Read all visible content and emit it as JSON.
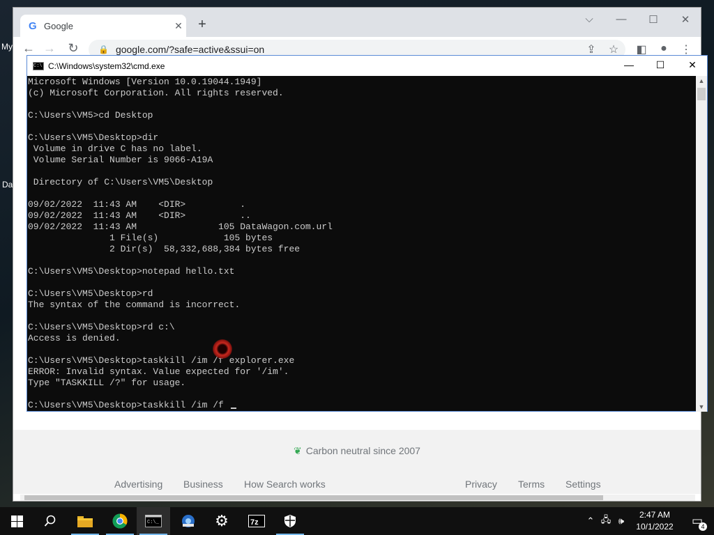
{
  "desktop": {
    "icon_labels": [
      "My",
      "Da"
    ]
  },
  "chrome": {
    "tab_title": "Google",
    "url": "google.com/?safe=active&ssui=on",
    "footer": {
      "carbon_text": "Carbon neutral since 2007",
      "left_links": [
        "Advertising",
        "Business",
        "How Search works"
      ],
      "right_links": [
        "Privacy",
        "Terms",
        "Settings"
      ]
    }
  },
  "cmd": {
    "title": "C:\\Windows\\system32\\cmd.exe",
    "lines": [
      "Microsoft Windows [Version 10.0.19044.1949]",
      "(c) Microsoft Corporation. All rights reserved.",
      "",
      "C:\\Users\\VM5>cd Desktop",
      "",
      "C:\\Users\\VM5\\Desktop>dir",
      " Volume in drive C has no label.",
      " Volume Serial Number is 9066-A19A",
      "",
      " Directory of C:\\Users\\VM5\\Desktop",
      "",
      "09/02/2022  11:43 AM    <DIR>          .",
      "09/02/2022  11:43 AM    <DIR>          ..",
      "09/02/2022  11:43 AM               105 DataWagon.com.url",
      "               1 File(s)            105 bytes",
      "               2 Dir(s)  58,332,688,384 bytes free",
      "",
      "C:\\Users\\VM5\\Desktop>notepad hello.txt",
      "",
      "C:\\Users\\VM5\\Desktop>rd",
      "The syntax of the command is incorrect.",
      "",
      "C:\\Users\\VM5\\Desktop>rd c:\\",
      "Access is denied.",
      "",
      "C:\\Users\\VM5\\Desktop>taskkill /im /f explorer.exe",
      "ERROR: Invalid syntax. Value expected for '/im'.",
      "Type \"TASKKILL /?\" for usage.",
      "",
      "C:\\Users\\VM5\\Desktop>taskkill /im /f "
    ]
  },
  "taskbar": {
    "apps": [
      "start",
      "search",
      "file-explorer",
      "chrome",
      "cmd",
      "app-5",
      "settings",
      "7zip",
      "security"
    ],
    "time": "2:47 AM",
    "date": "10/1/2022",
    "notification_count": "4"
  }
}
